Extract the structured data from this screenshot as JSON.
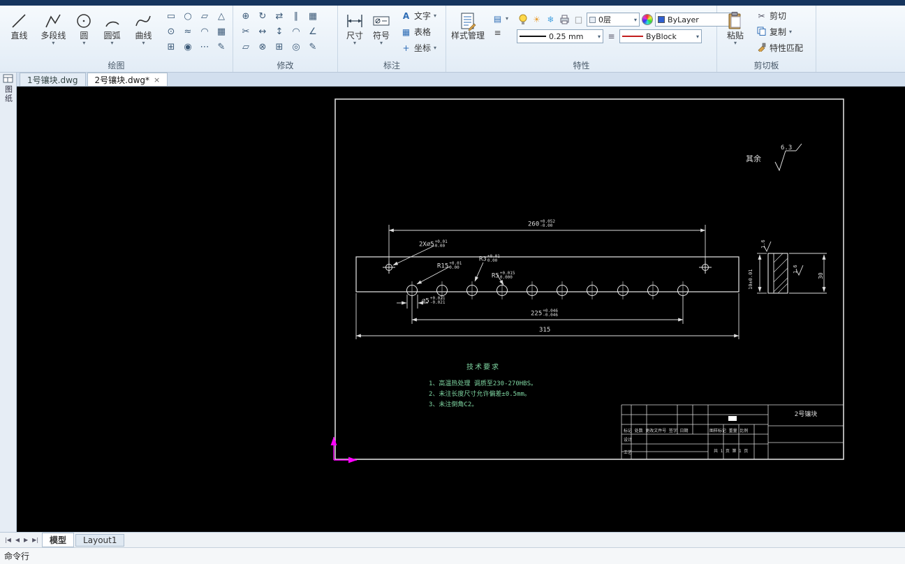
{
  "ribbon": {
    "draw": {
      "label": "绘图",
      "line": "直线",
      "polyline": "多段线",
      "circle": "圆",
      "arc": "圆弧",
      "spline": "曲线"
    },
    "modify": {
      "label": "修改"
    },
    "annotate": {
      "label": "标注",
      "dim": "尺寸",
      "symbol": "符号",
      "text": "文字",
      "table": "表格",
      "coord": "坐标"
    },
    "properties": {
      "label": "特性",
      "style_mgr": "样式管理",
      "layer": "0层",
      "color": "ByLayer",
      "lineweight": "0.25 mm",
      "linetype": "ByBlock"
    },
    "clipboard": {
      "label": "剪切板",
      "paste": "粘贴",
      "cut": "剪切",
      "copy": "复制",
      "match": "特性匹配"
    }
  },
  "icons": {
    "carat": "▾",
    "draw_small": [
      "▭",
      "○",
      "▱",
      "△",
      "⊙",
      "≈",
      "◠",
      "▦",
      "⊞",
      "◉",
      "⋯",
      "✎"
    ],
    "modify": [
      "⊕",
      "↻",
      "⇄",
      "∥",
      "▦",
      "✂",
      "↔",
      "↕",
      "◠",
      "∠",
      "▱",
      "⊗",
      "⊞",
      "◎",
      "✎"
    ],
    "text_tool": "A",
    "table_tool": "▦",
    "coord_tool": "+",
    "cut_tool": "✂",
    "sun": "☀",
    "freeze": "❄",
    "box": "□",
    "menu": "≡",
    "layers_small": "▤",
    "hatch_lines": "≡",
    "nav": [
      "|◀",
      "◀",
      "▶",
      "▶|"
    ],
    "close": "×"
  },
  "doc_tabs": {
    "tab1": "1号镶块.dwg",
    "tab2": "2号镶块.dwg*"
  },
  "side_panel": {
    "label": "图纸"
  },
  "drawing": {
    "surface": {
      "prefix": "其余",
      "value": "6.3"
    },
    "dim260": {
      "v": "260",
      "sup": "+0.052",
      "sub": "-0.00"
    },
    "dim2x5": {
      "v": "2X∅5",
      "sup": "+0.01",
      "sub": "0.00"
    },
    "r15": {
      "v": "R15",
      "sup": "+0.01",
      "sub": "0.00"
    },
    "r3": {
      "v": "R3",
      "sup": "+0.01",
      "sub": "0.00"
    },
    "r5": {
      "v": "R5",
      "sup": "+0.015",
      "sub": "0.000"
    },
    "d5": {
      "v": "∅5",
      "sup": "+0.021",
      "sub": "-0.021"
    },
    "dim225": {
      "v": "225",
      "sup": "+0.046",
      "sub": "-0.046"
    },
    "dim315": "315",
    "side_width": "10±0.01",
    "side_height": "30",
    "rough_a": "1.6",
    "rough_b": "1.6",
    "tech": {
      "title": "技术要求",
      "l1": "1、高温热处理 调质至230-270HBS。",
      "l2": "2、未注长度尺寸允许偏差±0.5mm。",
      "l3": "3、未注倒角C2。"
    },
    "title_block": {
      "name": "2号镶块",
      "header_row": "标记 处数 更改文件号 签字 日期",
      "left1": "设计",
      "left2": "工艺",
      "mid": "图样标记  重量  比例",
      "sheet": "共 1 页  第 1 页"
    }
  },
  "statusbar": {
    "model": "模型",
    "layout1": "Layout1",
    "command": "命令行"
  }
}
